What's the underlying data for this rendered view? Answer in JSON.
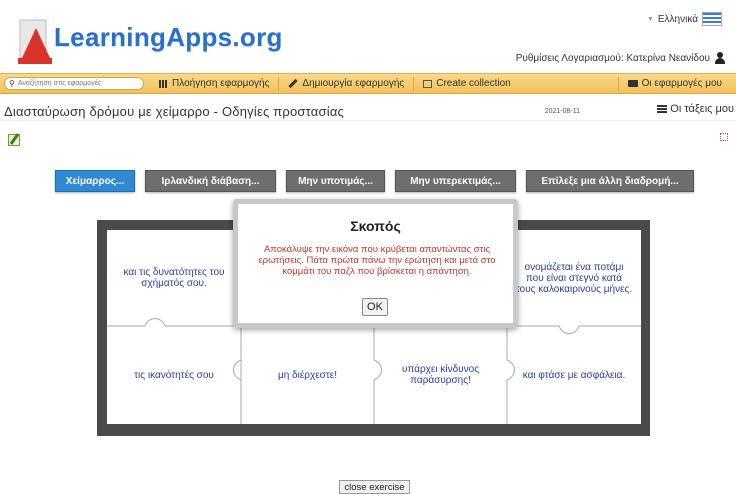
{
  "header": {
    "logo_text": "LearningApps.org",
    "language": "Ελληνικά",
    "account_label": "Ρυθμίσεις Λογαριασμού: Κατερίνα Νεανίδου"
  },
  "nav": {
    "search_placeholder": "Αναζήτηση στις εφαρμογές",
    "browse": "Πλοήγηση εφαρμογής",
    "create_app": "Δημιουργία εφαρμογής",
    "create_collection": "Create collection",
    "my_apps": "Οι εφαρμογές μου"
  },
  "page": {
    "title": "Διασταύρωση δρόμου με χείμαρρο - Οδηγίες προστασίας",
    "date": "2021-08-11",
    "my_classes": "Οι τάξεις μου"
  },
  "routes": [
    {
      "label": "Χείμαρρος...",
      "active": true
    },
    {
      "label": "Ιρλανδική διάβαση...",
      "active": false
    },
    {
      "label": "Μην υποτιμάς...",
      "active": false
    },
    {
      "label": "Μην υπερεκτιμάς...",
      "active": false
    },
    {
      "label": "Επίλεξε μια άλλη διαδρομή...",
      "active": false
    }
  ],
  "pieces": [
    "και τις δυνατότητες του σχήματός σου.",
    "",
    "",
    "ονομάζεται ένα ποτάμι που είναι στεγνό κατά τους καλοκαιρινούς μήνες.",
    "τις ικανότητές σου",
    "μη διέρχεστε!",
    "υπάρχει κίνδυνος παράσυρσης!",
    "και φτάσε με ασφάλεια."
  ],
  "modal": {
    "title": "Σκοπός",
    "text": "Αποκάλυψε την εικόνα που κρύβεται απαντώντας στις ερωτήσεις. Πάτα πρώτα πάνω την ερώτηση και μετά στο κομμάτι του παζλ που βρίσκεται η απάντηση.",
    "ok": "OK"
  },
  "footer": {
    "close_exercise": "close exercise"
  },
  "colors": {
    "nav_bar": "#f0c25c",
    "active_route": "#2f8ad6",
    "route": "#6e6e6e",
    "modal_text": "#c8342a",
    "piece_text": "#2a3aa8"
  }
}
